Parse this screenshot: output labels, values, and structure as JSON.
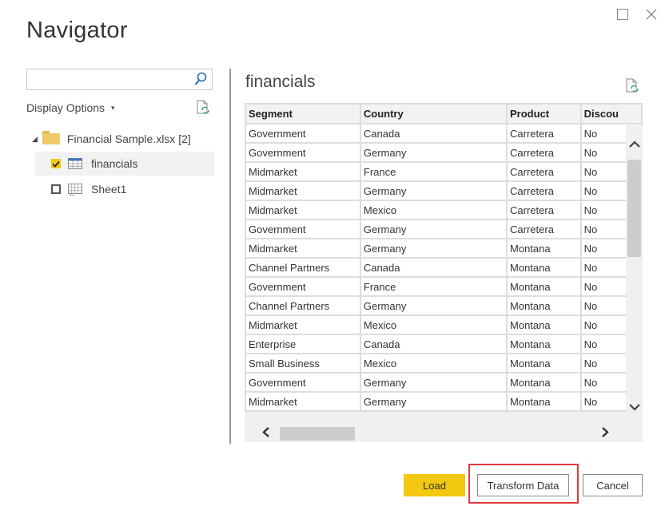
{
  "window": {
    "title": "Navigator",
    "maximize_icon": "maximize-icon",
    "close_icon": "close-icon",
    "close_glyph": "✕"
  },
  "left_pane": {
    "search": {
      "value": "",
      "placeholder": "",
      "icon": "search-icon"
    },
    "display_options_label": "Display Options",
    "display_options_caret": "▾",
    "refresh_icon": "refresh-icon",
    "tree": {
      "root": {
        "label": "Financial Sample.xlsx [2]",
        "expanded": true,
        "icon": "folder-icon",
        "toggle_glyph": "◢"
      },
      "items": [
        {
          "label": "financials",
          "checked": true,
          "selected": true,
          "icon": "table-icon"
        },
        {
          "label": "Sheet1",
          "checked": false,
          "selected": false,
          "icon": "sheet-icon"
        }
      ]
    }
  },
  "preview": {
    "title": "financials",
    "refresh_icon": "refresh-icon",
    "columns": [
      "Segment",
      "Country",
      "Product",
      "Discou"
    ],
    "rows": [
      [
        "Government",
        "Canada",
        "Carretera",
        "No"
      ],
      [
        "Government",
        "Germany",
        "Carretera",
        "No"
      ],
      [
        "Midmarket",
        "France",
        "Carretera",
        "No"
      ],
      [
        "Midmarket",
        "Germany",
        "Carretera",
        "No"
      ],
      [
        "Midmarket",
        "Mexico",
        "Carretera",
        "No"
      ],
      [
        "Government",
        "Germany",
        "Carretera",
        "No"
      ],
      [
        "Midmarket",
        "Germany",
        "Montana",
        "No"
      ],
      [
        "Channel Partners",
        "Canada",
        "Montana",
        "No"
      ],
      [
        "Government",
        "France",
        "Montana",
        "No"
      ],
      [
        "Channel Partners",
        "Germany",
        "Montana",
        "No"
      ],
      [
        "Midmarket",
        "Mexico",
        "Montana",
        "No"
      ],
      [
        "Enterprise",
        "Canada",
        "Montana",
        "No"
      ],
      [
        "Small Business",
        "Mexico",
        "Montana",
        "No"
      ],
      [
        "Government",
        "Germany",
        "Montana",
        "No"
      ],
      [
        "Midmarket",
        "Germany",
        "Montana",
        "No"
      ]
    ],
    "scroll": {
      "up_glyph": "⌃",
      "down_glyph": "⌄",
      "left_glyph": "❮",
      "right_glyph": "❯"
    }
  },
  "footer": {
    "load_label": "Load",
    "transform_label": "Transform Data",
    "cancel_label": "Cancel",
    "accent_color": "#f2c811",
    "highlight_color": "#e0393e"
  }
}
